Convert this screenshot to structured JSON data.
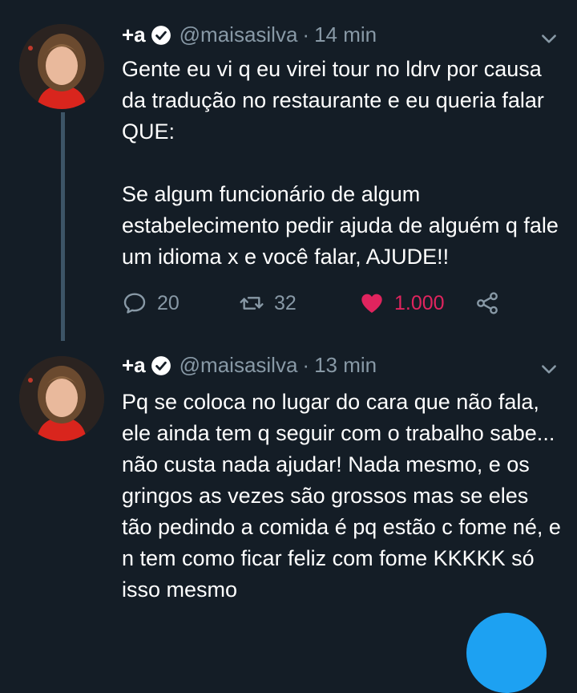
{
  "tweets": [
    {
      "name": "+a",
      "handle": "@maisasilva",
      "separator": "·",
      "time": "14 min",
      "text": "Gente eu vi q eu virei tour no ldrv por causa da tradução no restaurante e eu queria falar QUE:\n\nSe algum funcionário de algum estabelecimento pedir ajuda de alguém q fale um idioma x e você falar, AJUDE!!",
      "replies": "20",
      "retweets": "32",
      "likes": "1.000",
      "liked": true
    },
    {
      "name": "+a",
      "handle": "@maisasilva",
      "separator": "·",
      "time": "13 min",
      "text": "Pq se coloca no lugar do cara que não fala, ele ainda tem q seguir com o trabalho sabe... não custa nada ajudar! Nada mesmo, e os gringos as vezes são grossos mas se eles tão pedindo a comida é pq estão c fome né, e n tem como ficar feliz com fome KKKKK só isso mesmo"
    }
  ],
  "colors": {
    "background": "#141d26",
    "secondary_text": "#8899a6",
    "like": "#e0245e",
    "accent": "#1da1f2"
  },
  "icons": [
    "verified-icon",
    "chevron-down-icon",
    "reply-icon",
    "retweet-icon",
    "heart-icon",
    "share-icon"
  ]
}
